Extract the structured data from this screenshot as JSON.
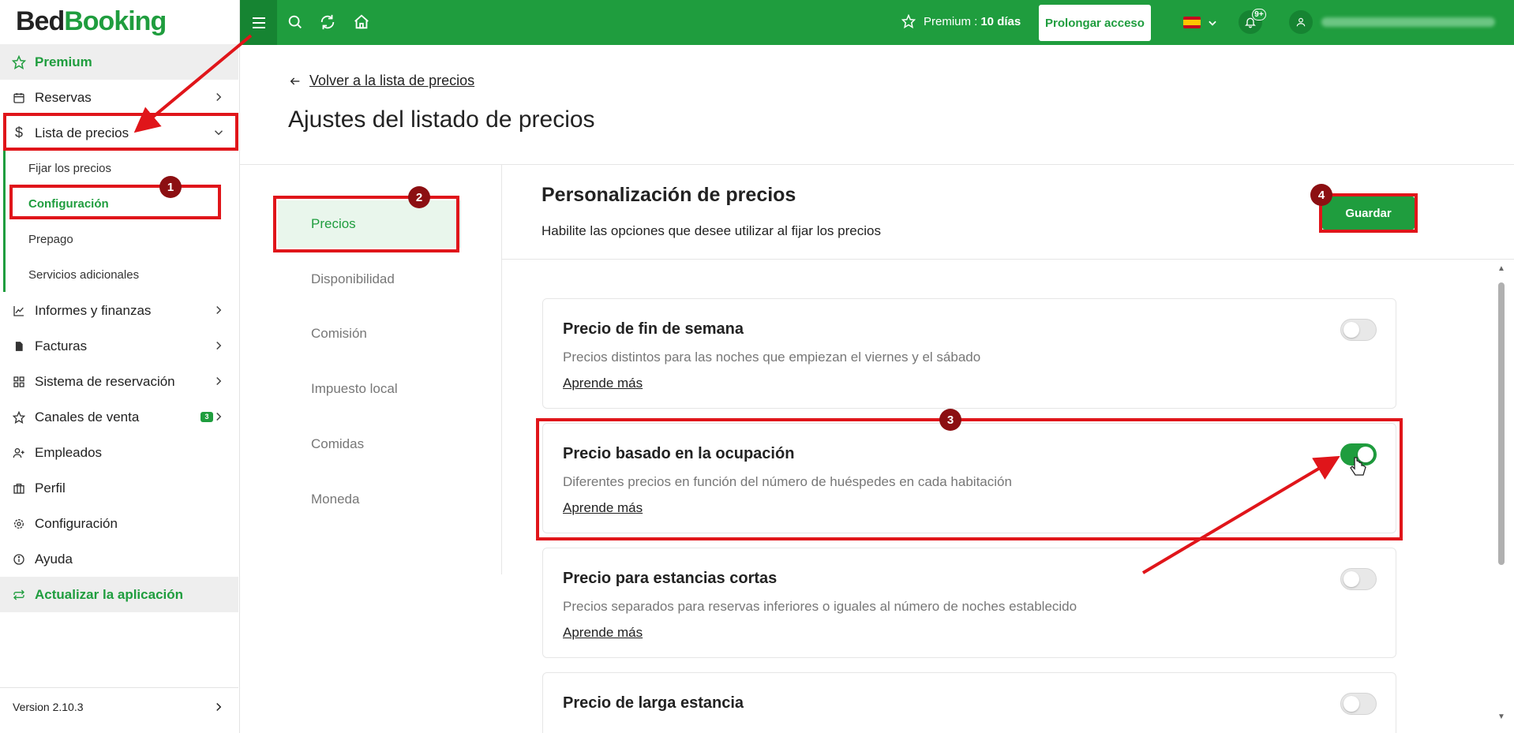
{
  "logo": {
    "part1": "Bed",
    "part2": "Booking"
  },
  "sidebar": {
    "premium": "Premium",
    "items": [
      {
        "label": "Reservas"
      },
      {
        "label": "Lista de precios"
      },
      {
        "label": "Informes y finanzas"
      },
      {
        "label": "Facturas"
      },
      {
        "label": "Sistema de reservación"
      },
      {
        "label": "Canales de venta",
        "badge": "3"
      },
      {
        "label": "Empleados"
      },
      {
        "label": "Perfil"
      },
      {
        "label": "Configuración"
      },
      {
        "label": "Ayuda"
      }
    ],
    "subitems": [
      {
        "label": "Fijar los precios"
      },
      {
        "label": "Configuración"
      },
      {
        "label": "Prepago"
      },
      {
        "label": "Servicios adicionales"
      }
    ],
    "update": "Actualizar la aplicación",
    "version": "Version 2.10.3"
  },
  "topbar": {
    "premium_label": "Premium :",
    "premium_days": "10 días",
    "prolong": "Prolongar acceso",
    "notif_count": "9+"
  },
  "page": {
    "back": "Volver a la lista de precios",
    "title": "Ajustes del listado de precios"
  },
  "tabs": [
    {
      "label": "Precios"
    },
    {
      "label": "Disponibilidad"
    },
    {
      "label": "Comisión"
    },
    {
      "label": "Impuesto local"
    },
    {
      "label": "Comidas"
    },
    {
      "label": "Moneda"
    }
  ],
  "section": {
    "title": "Personalización de precios",
    "subtitle": "Habilite las opciones que desee utilizar al fijar los precios",
    "save": "Guardar"
  },
  "cards": [
    {
      "title": "Precio de fin de semana",
      "desc": "Precios distintos para las noches que empiezan el viernes y el sábado",
      "link": "Aprende más",
      "enabled": false
    },
    {
      "title": "Precio basado en la ocupación",
      "desc": "Diferentes precios en función del número de huéspedes en cada habitación",
      "link": "Aprende más",
      "enabled": true
    },
    {
      "title": "Precio para estancias cortas",
      "desc": "Precios separados para reservas inferiores o iguales al número de noches establecido",
      "link": "Aprende más",
      "enabled": false
    },
    {
      "title": "Precio de larga estancia",
      "enabled": false
    }
  ],
  "annotations": [
    "1",
    "2",
    "3",
    "4"
  ],
  "colors": {
    "brand": "#1f9d3e",
    "annotation": "#e0151a"
  }
}
